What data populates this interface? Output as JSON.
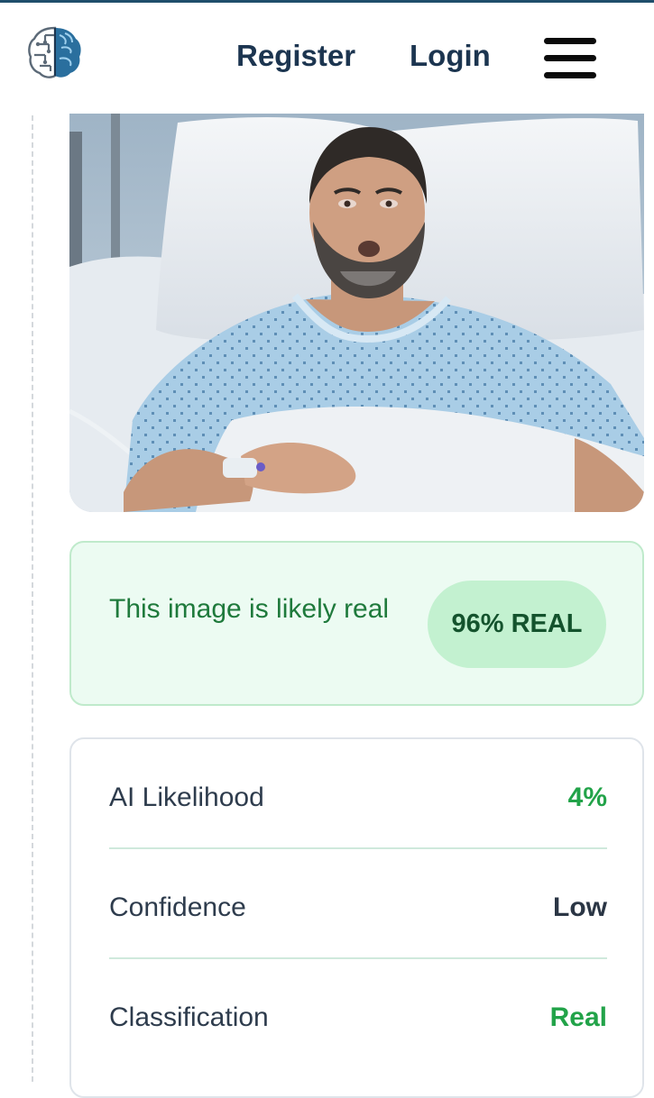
{
  "header": {
    "logo_icon": "brain-icon",
    "nav": {
      "register": "Register",
      "login": "Login"
    },
    "menu_icon": "hamburger-menu-icon"
  },
  "photo": {
    "alt": "Man lying in a hospital bed wearing a patterned hospital gown with an IV line in his hand"
  },
  "result": {
    "message": "This image is likely real",
    "badge": "96% REAL",
    "accent_color": "#1f7a3c",
    "background_color": "#ecfbf2"
  },
  "stats": [
    {
      "label": "AI Likelihood",
      "value": "4%",
      "value_color": "#22a349"
    },
    {
      "label": "Confidence",
      "value": "Low",
      "value_color": "#2b3645"
    },
    {
      "label": "Classification",
      "value": "Real",
      "value_color": "#22a349"
    }
  ]
}
